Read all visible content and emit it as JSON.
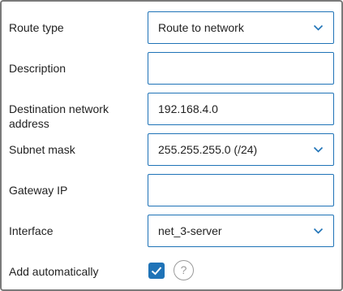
{
  "form": {
    "route_type": {
      "label": "Route type",
      "value": "Route to network",
      "icon": "chevron-down-icon"
    },
    "description": {
      "label": "Description",
      "value": ""
    },
    "destination": {
      "label_line1": "Destination network",
      "label_line2": "address",
      "value": "192.168.4.0"
    },
    "subnet_mask": {
      "label": "Subnet mask",
      "value": "255.255.255.0 (/24)",
      "icon": "chevron-down-icon"
    },
    "gateway_ip": {
      "label": "Gateway IP",
      "value": ""
    },
    "interface": {
      "label": "Interface",
      "value": "net_3-server",
      "icon": "chevron-down-icon"
    },
    "add_automatically": {
      "label": "Add automatically",
      "checked": true,
      "help_glyph": "?"
    }
  },
  "colors": {
    "accent": "#1f73b7",
    "border": "#7a7a7a",
    "help": "#9a9a9a"
  }
}
